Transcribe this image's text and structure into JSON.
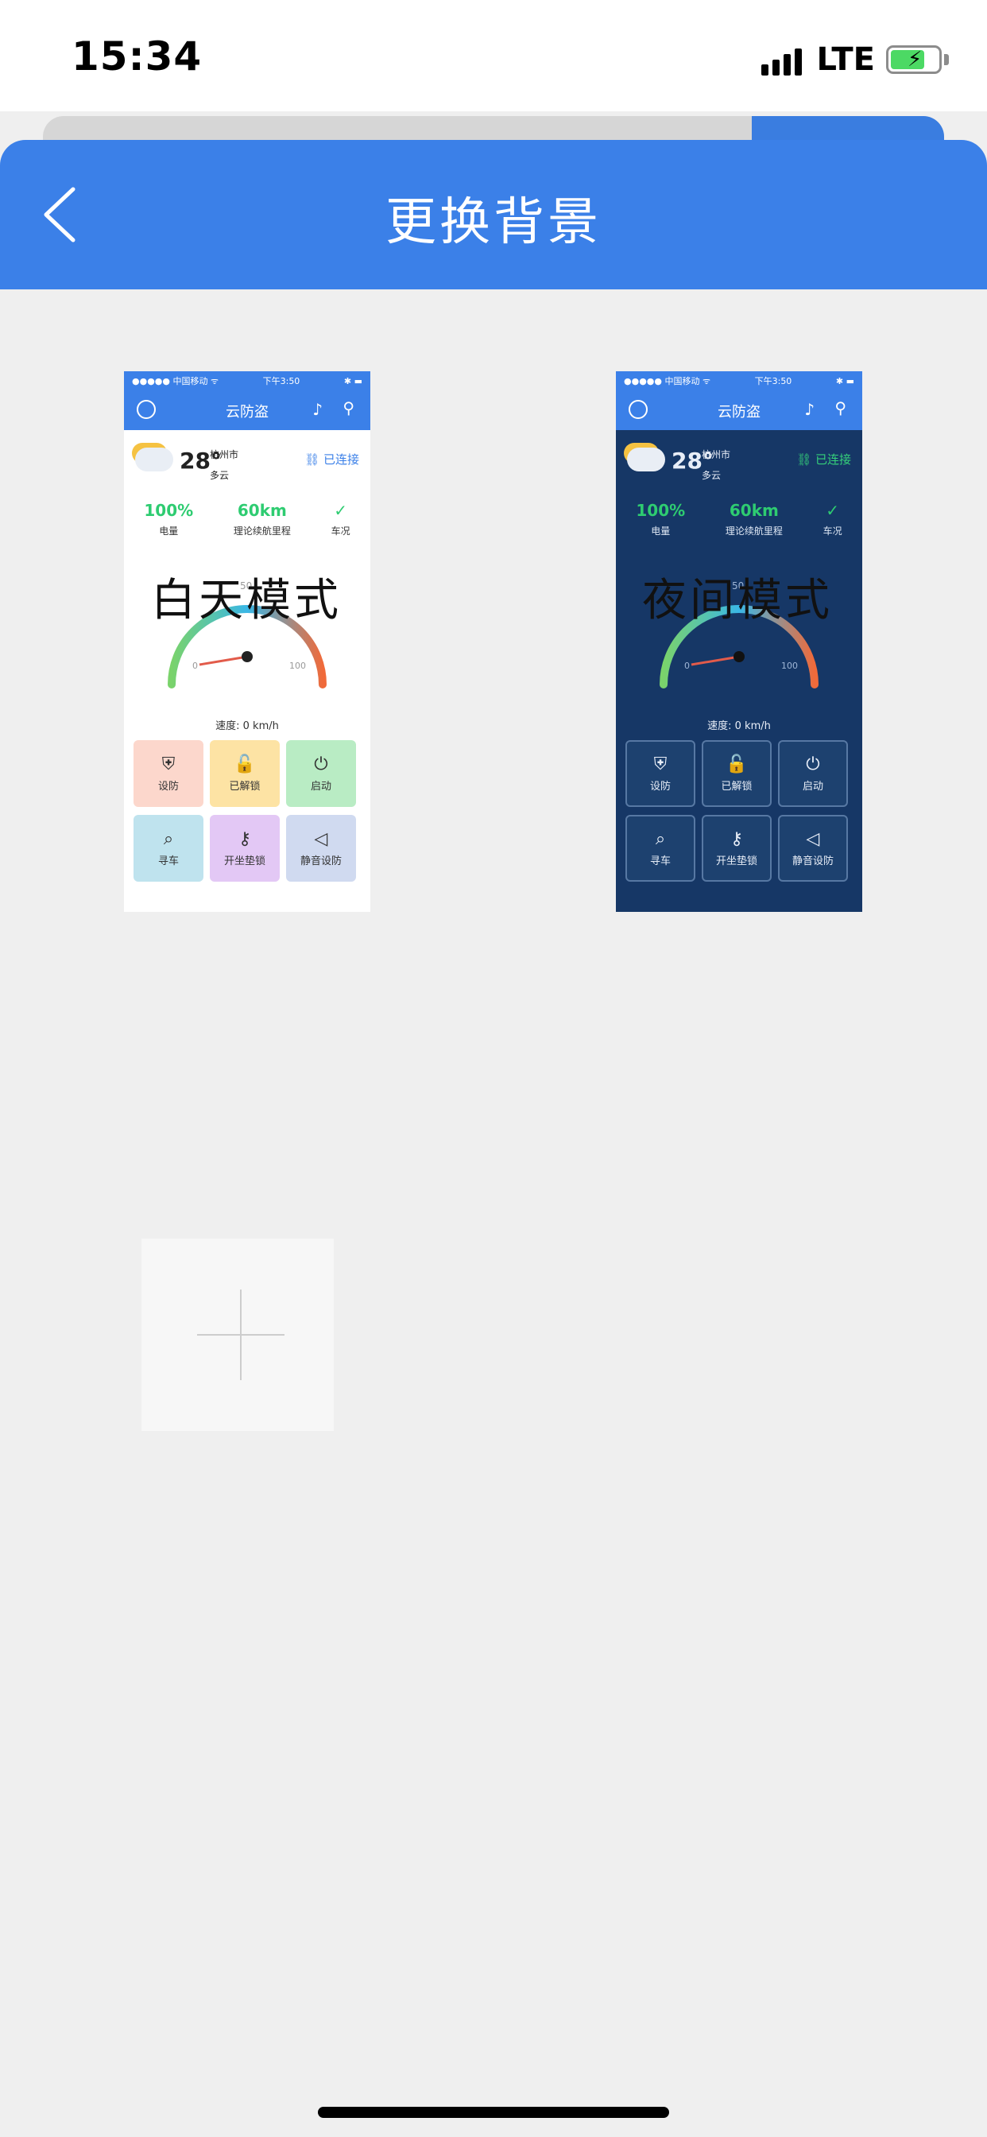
{
  "status_bar": {
    "time": "15:34",
    "network": "LTE",
    "signal_icon": "signal-bars-icon",
    "battery_icon": "battery-charging-icon"
  },
  "nav": {
    "title": "更换背景",
    "back_icon": "chevron-left-icon"
  },
  "themes": [
    {
      "label": "白天模式",
      "preview": {
        "status_left": "●●●●● 中国移动 ᯤ",
        "status_center": "下午3:50",
        "status_right": "✱ ▬",
        "app_title": "云防盗",
        "temp": "28°",
        "city": "杭州市",
        "weather": "多云",
        "link_status": "已连接",
        "battery_value": "100%",
        "battery_label": "电量",
        "range_value": "60km",
        "range_label": "理论续航里程",
        "condition_label": "车况",
        "gauge_ticks": [
          "0",
          "50",
          "100"
        ],
        "speed_text": "速度: 0 km/h",
        "buttons": [
          "设防",
          "已解锁",
          "启动",
          "寻车",
          "开坐垫锁",
          "静音设防"
        ]
      }
    },
    {
      "label": "夜间模式",
      "preview": {
        "status_left": "●●●●● 中国移动 ᯤ",
        "status_center": "下午3:50",
        "status_right": "✱ ▬",
        "app_title": "云防盗",
        "temp": "28°",
        "city": "杭州市",
        "weather": "多云",
        "link_status": "已连接",
        "battery_value": "100%",
        "battery_label": "电量",
        "range_value": "60km",
        "range_label": "理论续航里程",
        "condition_label": "车况",
        "gauge_ticks": [
          "0",
          "50",
          "100"
        ],
        "speed_text": "速度: 0 km/h",
        "buttons": [
          "设防",
          "已解锁",
          "启动",
          "寻车",
          "开坐垫锁",
          "静音设防"
        ]
      }
    }
  ],
  "add_tile": {
    "icon": "plus-icon"
  },
  "colors": {
    "primary": "#3b80e8",
    "background": "#efefef",
    "night_bg": "#163766",
    "green": "#2ecc71"
  }
}
